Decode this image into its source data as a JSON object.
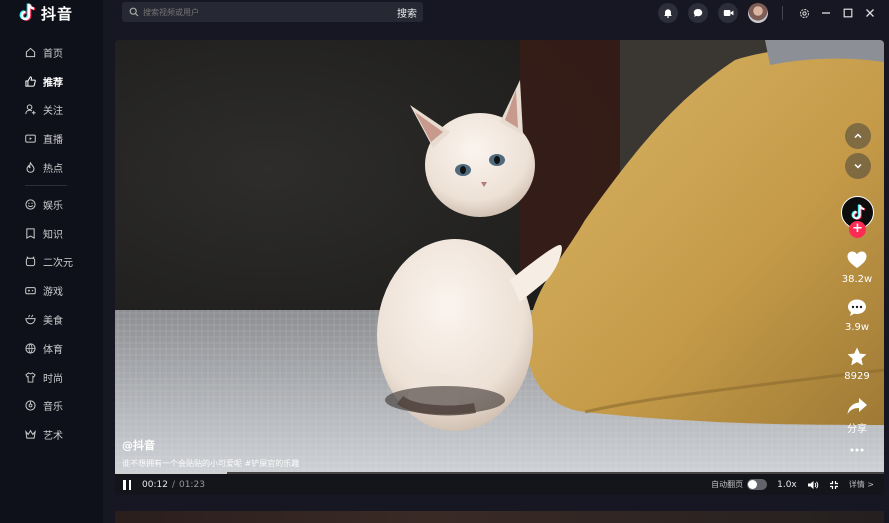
{
  "app": {
    "logo_text": "抖音",
    "brand_colors": {
      "cyan": "#25f4ee",
      "pink": "#fe2c55",
      "background": "#161722"
    }
  },
  "sidebar": {
    "items": [
      {
        "label": "首页",
        "icon": "home-icon"
      },
      {
        "label": "推荐",
        "icon": "thumb-up-icon",
        "active": true
      },
      {
        "label": "关注",
        "icon": "user-plus-icon"
      },
      {
        "label": "直播",
        "icon": "tv-icon"
      },
      {
        "label": "热点",
        "icon": "flame-icon"
      }
    ],
    "categories": [
      {
        "label": "娱乐",
        "icon": "smile-icon"
      },
      {
        "label": "知识",
        "icon": "book-icon"
      },
      {
        "label": "二次元",
        "icon": "alarm-clock-icon"
      },
      {
        "label": "游戏",
        "icon": "gamepad-icon"
      },
      {
        "label": "美食",
        "icon": "bowl-icon"
      },
      {
        "label": "体育",
        "icon": "ball-icon"
      },
      {
        "label": "时尚",
        "icon": "shirt-icon"
      },
      {
        "label": "音乐",
        "icon": "music-icon"
      },
      {
        "label": "艺术",
        "icon": "crown-icon"
      }
    ]
  },
  "topbar": {
    "search_placeholder": "搜索视频或用户",
    "search_button": "搜索"
  },
  "video": {
    "author": "@抖音",
    "description": "谁不想拥有一个会贴贴的小可爱呢 #铲屎官的乐趣",
    "current_time": "00:12",
    "separator": "/",
    "total_time": "01:23",
    "progress_fraction": 0.145,
    "autoplay_label": "自动翻页",
    "autoplay_on": false,
    "speed": "1.0x",
    "details_label": "详情 >"
  },
  "actions": {
    "likes": "38.2w",
    "comments": "3.9w",
    "favorites": "8929",
    "share_label": "分享"
  }
}
